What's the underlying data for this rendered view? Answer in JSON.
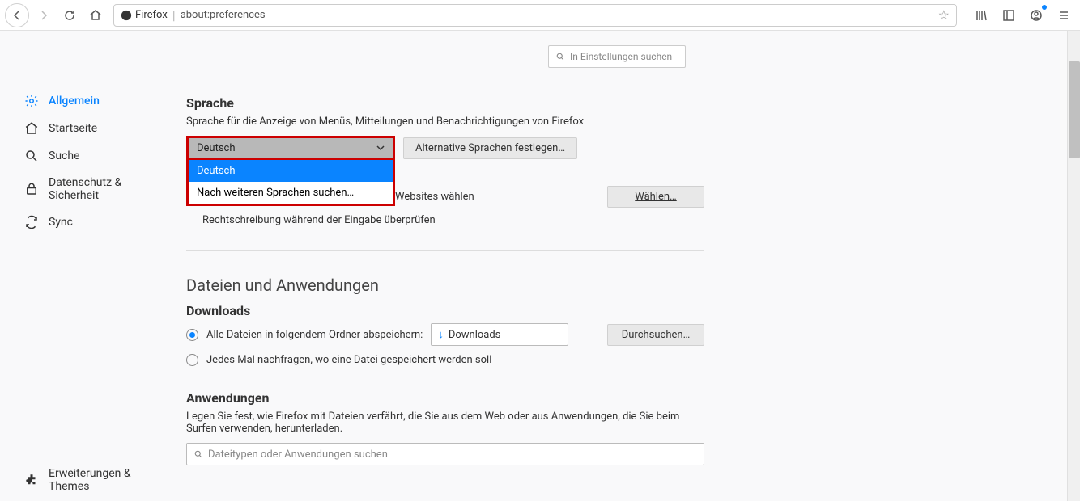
{
  "toolbar": {
    "identity_label": "Firefox",
    "url": "about:preferences"
  },
  "sidebar": {
    "items": [
      {
        "label": "Allgemein"
      },
      {
        "label": "Startseite"
      },
      {
        "label": "Suche"
      },
      {
        "label": "Datenschutz & Sicherheit"
      },
      {
        "label": "Sync"
      }
    ],
    "footer": "Erweiterungen & Themes"
  },
  "search": {
    "placeholder": "In Einstellungen suchen"
  },
  "language": {
    "heading": "Sprache",
    "desc": "Sprache für die Anzeige von Menüs, Mitteilungen und Benachrichtigungen von Firefox",
    "selected": "Deutsch",
    "options": [
      "Deutsch",
      "Nach weiteren Sprachen suchen…"
    ],
    "alt_button": "Alternative Sprachen festlegen…",
    "obscured_text": "Websites wählen",
    "choose_button": "Wählen…",
    "spellcheck": "Rechtschreibung während der Eingabe überprüfen"
  },
  "files": {
    "heading": "Dateien und Anwendungen",
    "downloads_heading": "Downloads",
    "radio_save_label": "Alle Dateien in folgendem Ordner abspeichern:",
    "folder": "Downloads",
    "browse_button": "Durchsuchen…",
    "radio_ask_label": "Jedes Mal nachfragen, wo eine Datei gespeichert werden soll"
  },
  "apps": {
    "heading": "Anwendungen",
    "desc": "Legen Sie fest, wie Firefox mit Dateien verfährt, die Sie aus dem Web oder aus Anwendungen, die Sie beim Surfen verwenden, herunterladen.",
    "search_placeholder": "Dateitypen oder Anwendungen suchen"
  }
}
